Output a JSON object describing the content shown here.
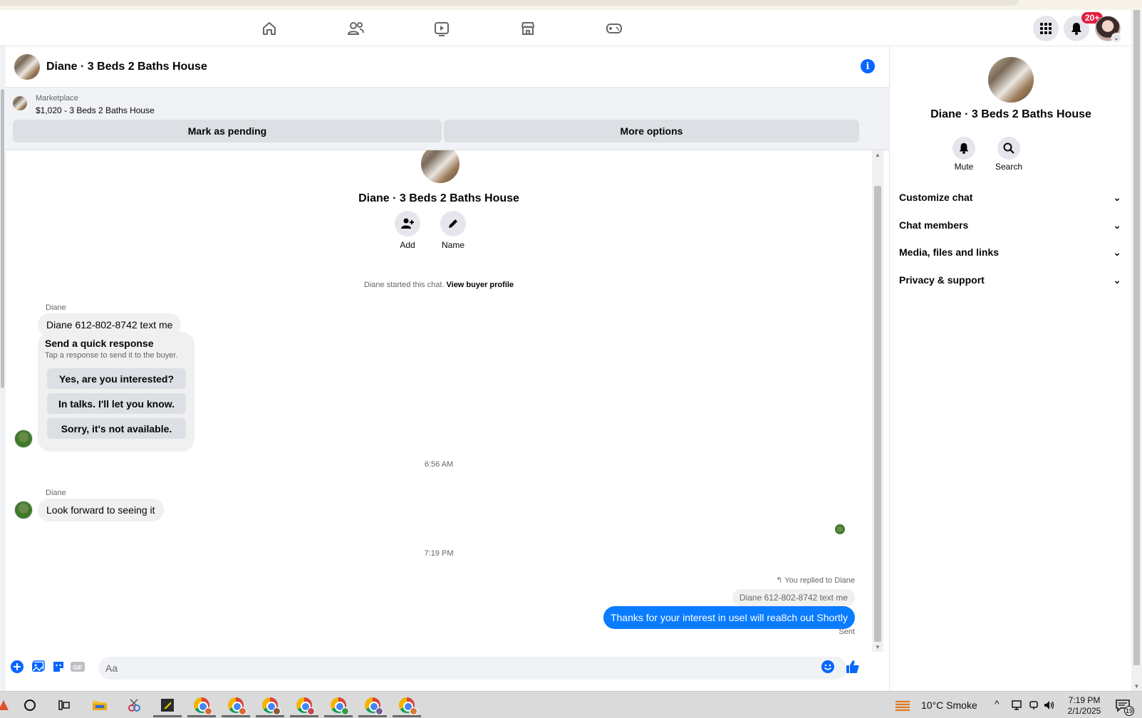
{
  "chat": {
    "title": "Diane · 3 Beds 2 Baths House",
    "marketplace_label": "Marketplace",
    "listing": "$1,020 - 3 Beds 2 Baths House",
    "mark_pending": "Mark as pending",
    "more_options": "More options"
  },
  "intro": {
    "title": "Diane · 3 Beds 2 Baths House",
    "add_label": "Add",
    "name_label": "Name",
    "started_text": "Diane started this chat.",
    "view_profile": "View buyer profile"
  },
  "messages": {
    "sender1": "Diane",
    "msg1": "Diane 612-802-8742 text me",
    "quick_title": "Send a quick response",
    "quick_sub": "Tap a response to send it to the buyer.",
    "quick_options": [
      "Yes, are you interested?",
      "In talks. I'll let you know.",
      "Sorry, it's not available."
    ],
    "time1": "6:56 AM",
    "sender2": "Diane",
    "msg2": "Look forward to seeing it",
    "time2": "7:19 PM",
    "reply_note": "You replied to Diane",
    "reply_quote": "Diane 612-802-8742 text me",
    "my_msg": "Thanks for your interest in useI will rea8ch out Shortly",
    "sent": "Sent"
  },
  "composer": {
    "placeholder": "Aa"
  },
  "right_panel": {
    "title": "Diane · 3 Beds 2 Baths House",
    "mute": "Mute",
    "search": "Search",
    "sections": [
      "Customize chat",
      "Chat members",
      "Media, files and links",
      "Privacy & support"
    ]
  },
  "topbar": {
    "notif_badge": "20+"
  },
  "taskbar": {
    "weather": "10°C  Smoke",
    "time": "7:19 PM",
    "date": "2/1/2025",
    "notif_count": "19"
  },
  "colors": {
    "accent": "#0866ff",
    "my_bubble": "#0a7cff",
    "badge": "#e41e3f"
  }
}
